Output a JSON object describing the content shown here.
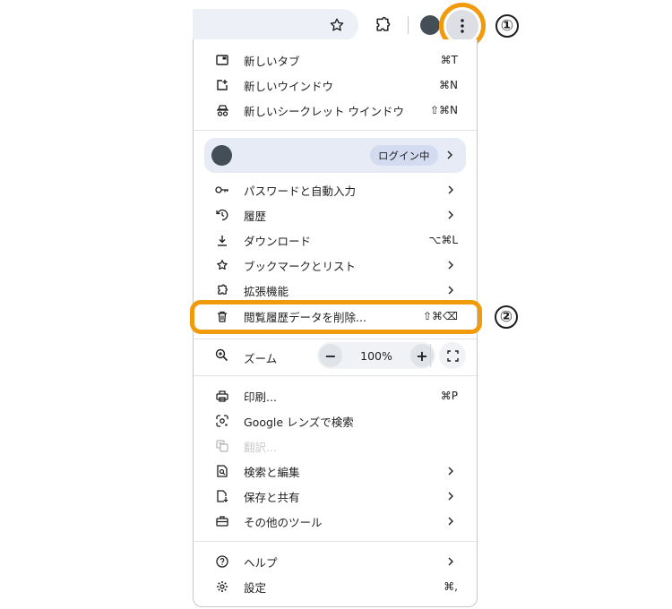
{
  "toolbar": {
    "icons": [
      "star-icon",
      "extensions-icon",
      "profile-avatar",
      "more-vert-icon"
    ],
    "callout_1": "①",
    "callout_2": "②"
  },
  "menu": {
    "new_tab": {
      "label": "新しいタブ",
      "shortcut": "⌘T"
    },
    "new_window": {
      "label": "新しいウインドウ",
      "shortcut": "⌘N"
    },
    "new_incognito": {
      "label": "新しいシークレット ウインドウ",
      "shortcut": "⇧⌘N"
    },
    "profile": {
      "status": "ログイン中"
    },
    "passwords": {
      "label": "パスワードと自動入力"
    },
    "history": {
      "label": "履歴"
    },
    "downloads": {
      "label": "ダウンロード",
      "shortcut": "⌥⌘L"
    },
    "bookmarks": {
      "label": "ブックマークとリスト"
    },
    "extensions": {
      "label": "拡張機能"
    },
    "clear_data": {
      "label": "閲覧履歴データを削除...",
      "shortcut": "⇧⌘⌫"
    },
    "zoom": {
      "label": "ズーム",
      "value": "100%",
      "minus": "−",
      "plus": "+"
    },
    "print": {
      "label": "印刷...",
      "shortcut": "⌘P"
    },
    "lens": {
      "label": "Google レンズで検索"
    },
    "translate": {
      "label": "翻訳..."
    },
    "find_edit": {
      "label": "検索と編集"
    },
    "save_share": {
      "label": "保存と共有"
    },
    "more_tools": {
      "label": "その他のツール"
    },
    "help": {
      "label": "ヘルプ"
    },
    "settings": {
      "label": "設定",
      "shortcut": "⌘,"
    }
  },
  "colors": {
    "highlight": "#f19a0b",
    "avatar": "#444e58",
    "profile_bg": "#e7ebf6"
  }
}
